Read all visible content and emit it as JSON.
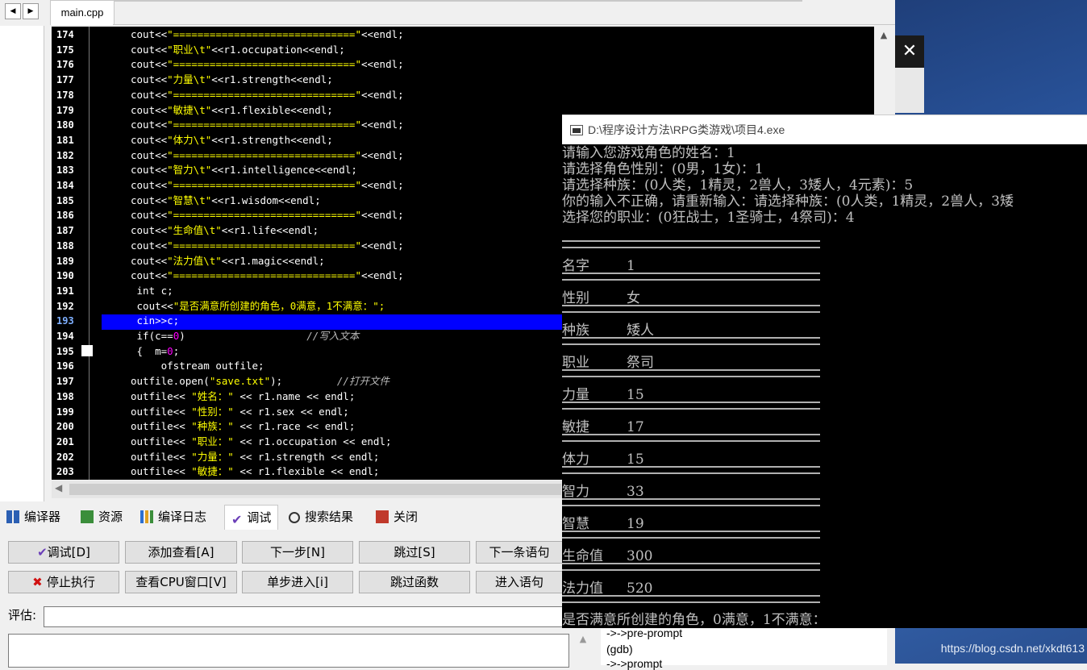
{
  "editor": {
    "tab": "main.cpp",
    "lines": [
      {
        "n": "174",
        "code": [
          [
            "cout<<",
            ""
          ],
          [
            "\"==============================\"",
            "str"
          ],
          [
            "<<endl;",
            ""
          ]
        ]
      },
      {
        "n": "175",
        "code": [
          [
            "cout<<",
            ""
          ],
          [
            "\"职业\\t\"",
            "str"
          ],
          [
            "<<r1.occupation<<endl;",
            ""
          ]
        ]
      },
      {
        "n": "176",
        "code": [
          [
            "cout<<",
            ""
          ],
          [
            "\"==============================\"",
            "str"
          ],
          [
            "<<endl;",
            ""
          ]
        ]
      },
      {
        "n": "177",
        "code": [
          [
            "cout<<",
            ""
          ],
          [
            "\"力量\\t\"",
            "str"
          ],
          [
            "<<r1.strength<<endl;",
            ""
          ]
        ]
      },
      {
        "n": "178",
        "code": [
          [
            "cout<<",
            ""
          ],
          [
            "\"==============================\"",
            "str"
          ],
          [
            "<<endl;",
            ""
          ]
        ]
      },
      {
        "n": "179",
        "code": [
          [
            "cout<<",
            ""
          ],
          [
            "\"敏捷\\t\"",
            "str"
          ],
          [
            "<<r1.flexible<<endl;",
            ""
          ]
        ]
      },
      {
        "n": "180",
        "code": [
          [
            "cout<<",
            ""
          ],
          [
            "\"==============================\"",
            "str"
          ],
          [
            "<<endl;",
            ""
          ]
        ]
      },
      {
        "n": "181",
        "code": [
          [
            "cout<<",
            ""
          ],
          [
            "\"体力\\t\"",
            "str"
          ],
          [
            "<<r1.strength<<endl;",
            ""
          ]
        ]
      },
      {
        "n": "182",
        "code": [
          [
            "cout<<",
            ""
          ],
          [
            "\"==============================\"",
            "str"
          ],
          [
            "<<endl;",
            ""
          ]
        ]
      },
      {
        "n": "183",
        "code": [
          [
            "cout<<",
            ""
          ],
          [
            "\"智力\\t\"",
            "str"
          ],
          [
            "<<r1.intelligence<<endl;",
            ""
          ]
        ]
      },
      {
        "n": "184",
        "code": [
          [
            "cout<<",
            ""
          ],
          [
            "\"==============================\"",
            "str"
          ],
          [
            "<<endl;",
            ""
          ]
        ]
      },
      {
        "n": "185",
        "code": [
          [
            "cout<<",
            ""
          ],
          [
            "\"智慧\\t\"",
            "str"
          ],
          [
            "<<r1.wisdom<<endl;",
            ""
          ]
        ]
      },
      {
        "n": "186",
        "code": [
          [
            "cout<<",
            ""
          ],
          [
            "\"==============================\"",
            "str"
          ],
          [
            "<<endl;",
            ""
          ]
        ]
      },
      {
        "n": "187",
        "code": [
          [
            "cout<<",
            ""
          ],
          [
            "\"生命值\\t\"",
            "str"
          ],
          [
            "<<r1.life<<endl;",
            ""
          ]
        ]
      },
      {
        "n": "188",
        "code": [
          [
            "cout<<",
            ""
          ],
          [
            "\"==============================\"",
            "str"
          ],
          [
            "<<endl;",
            ""
          ]
        ]
      },
      {
        "n": "189",
        "code": [
          [
            "cout<<",
            ""
          ],
          [
            "\"法力值\\t\"",
            "str"
          ],
          [
            "<<r1.magic<<endl;",
            ""
          ]
        ]
      },
      {
        "n": "190",
        "code": [
          [
            "cout<<",
            ""
          ],
          [
            "\"==============================\"",
            "str"
          ],
          [
            "<<endl;",
            ""
          ]
        ]
      },
      {
        "n": "191",
        "code": [
          [
            " int c;",
            ""
          ]
        ]
      },
      {
        "n": "192",
        "code": [
          [
            " cout<<",
            ""
          ],
          [
            "\"是否满意所创建的角色，0满意，1不满意：\";",
            "str"
          ]
        ]
      },
      {
        "n": "193",
        "code": [
          [
            " cin>>c;",
            ""
          ]
        ]
      },
      {
        "n": "194",
        "code": [
          [
            " if(c==",
            ""
          ],
          [
            "0",
            "num"
          ],
          [
            ")                    ",
            ""
          ],
          [
            "//写入文本",
            "cmt"
          ]
        ]
      },
      {
        "n": "195",
        "code": [
          [
            " {  m=",
            ""
          ],
          [
            "0",
            "num"
          ],
          [
            ";",
            ""
          ]
        ]
      },
      {
        "n": "196",
        "code": [
          [
            "     ofstream outfile;",
            ""
          ]
        ]
      },
      {
        "n": "197",
        "code": [
          [
            "outfile.open(",
            ""
          ],
          [
            "\"save.txt\"",
            "str"
          ],
          [
            ");         ",
            ""
          ],
          [
            "//打开文件",
            "cmt"
          ]
        ]
      },
      {
        "n": "198",
        "code": [
          [
            "outfile<< ",
            ""
          ],
          [
            "\"姓名：\"",
            "str"
          ],
          [
            " << r1.name << endl;",
            ""
          ]
        ]
      },
      {
        "n": "199",
        "code": [
          [
            "outfile<< ",
            ""
          ],
          [
            "\"性别：\"",
            "str"
          ],
          [
            " << r1.sex << endl;",
            ""
          ]
        ]
      },
      {
        "n": "200",
        "code": [
          [
            "outfile<< ",
            ""
          ],
          [
            "\"种族：\"",
            "str"
          ],
          [
            " << r1.race << endl;",
            ""
          ]
        ]
      },
      {
        "n": "201",
        "code": [
          [
            "outfile<< ",
            ""
          ],
          [
            "\"职业：\"",
            "str"
          ],
          [
            " << r1.occupation << endl;",
            ""
          ]
        ]
      },
      {
        "n": "202",
        "code": [
          [
            "outfile<< ",
            ""
          ],
          [
            "\"力量：\"",
            "str"
          ],
          [
            " << r1.strength << endl;",
            ""
          ]
        ]
      },
      {
        "n": "203",
        "code": [
          [
            "outfile<< ",
            ""
          ],
          [
            "\"敏捷：\"",
            "str"
          ],
          [
            " << r1.flexible << endl;",
            ""
          ]
        ]
      }
    ]
  },
  "bottom_tabs": [
    "编译器",
    "资源",
    "编译日志",
    "调试",
    "搜索结果",
    "关闭"
  ],
  "debug_buttons_row1": [
    "调试[D]",
    "添加查看[A]",
    "下一步[N]",
    "跳过[S]",
    "下一条语句"
  ],
  "debug_buttons_row2": [
    "停止执行",
    "查看CPU窗口[V]",
    "单步进入[i]",
    "跳过函数",
    "进入语句"
  ],
  "eval_label": "评估:",
  "gdb_output": [
    "->->pre-prompt",
    "(gdb)",
    "->->prompt"
  ],
  "console": {
    "title": "D:\\程序设计方法\\RPG类游戏\\项目4.exe",
    "lines": [
      "请输入您游戏角色的姓名：1",
      "请选择角色性别：(0男，1女)：1",
      "请选择种族：(0人类，1精灵，2兽人，3矮人，4元素)：5",
      "你的输入不正确，请重新输入：请选择种族：(0人类，1精灵，2兽人，3矮",
      "选择您的职业：(0狂战士，1圣骑士，4祭司)：4"
    ],
    "fields": [
      {
        "label": "名字",
        "value": "1"
      },
      {
        "label": "性别",
        "value": "女"
      },
      {
        "label": "种族",
        "value": "矮人"
      },
      {
        "label": "职业",
        "value": "祭司"
      },
      {
        "label": "力量",
        "value": "15"
      },
      {
        "label": "敏捷",
        "value": "17"
      },
      {
        "label": "体力",
        "value": "15"
      },
      {
        "label": "智力",
        "value": "33"
      },
      {
        "label": "智慧",
        "value": "19"
      },
      {
        "label": "生命值",
        "value": "300"
      },
      {
        "label": "法力值",
        "value": "520"
      }
    ],
    "prompt": "是否满意所创建的角色，0满意，1不满意："
  },
  "watermark": "https://blog.csdn.net/xkdt613",
  "close_glyph": "✕"
}
